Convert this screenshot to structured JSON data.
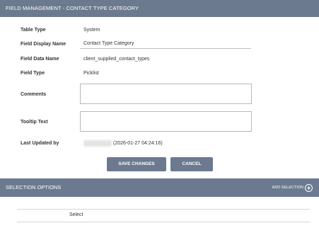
{
  "header": {
    "title": "FIELD MANAGEMENT - CONTACT TYPE CATEGORY"
  },
  "form": {
    "table_type_label": "Table Type",
    "table_type_value": "System",
    "display_name_label": "Field Display Name",
    "display_name_value": "Contact Type Category",
    "data_name_label": "Field Data Name",
    "data_name_value": "client_supplied_contact_types",
    "field_type_label": "Field Type",
    "field_type_value": "Picklist",
    "comments_label": "Comments",
    "comments_value": "",
    "tooltip_label": "Tooltip Text",
    "tooltip_value": "",
    "last_updated_label": "Last Updated by",
    "last_updated_timestamp": "(2026-01-27 04:24:16)"
  },
  "actions": {
    "save_label": "SAVE CHANGES",
    "cancel_label": "CANCEL"
  },
  "selection": {
    "title": "SELECTION OPTIONS",
    "add_label": "ADD SELECTION",
    "column_header": "Select"
  },
  "colors": {
    "bar": "#6b7a8f",
    "button": "#6b7a8f"
  },
  "icons": {
    "add": "plus-circle-icon"
  }
}
